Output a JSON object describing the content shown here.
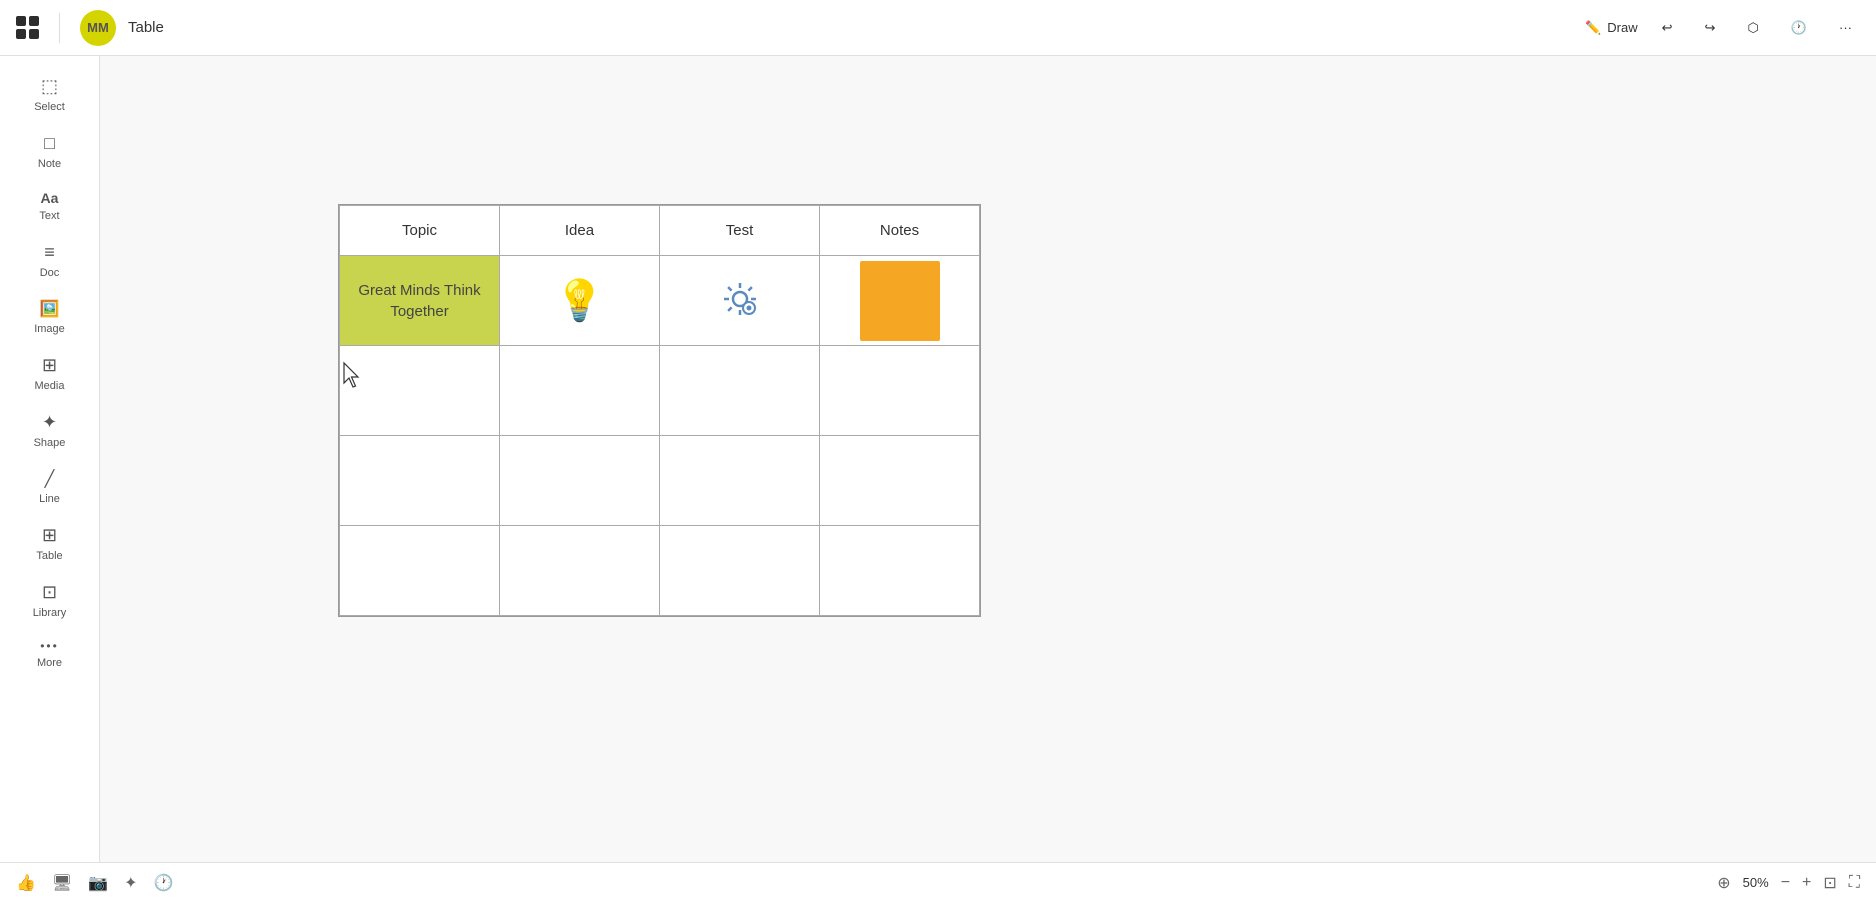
{
  "header": {
    "logo_label": "AFFiNE logo",
    "avatar_text": "MM",
    "doc_title": "Table",
    "draw_label": "Draw",
    "undo_label": "Undo",
    "redo_label": "Redo",
    "share_label": "Share",
    "history_label": "History",
    "more_label": "More"
  },
  "sidebar": {
    "items": [
      {
        "id": "select",
        "label": "Select",
        "icon": "⬚"
      },
      {
        "id": "note",
        "label": "Note",
        "icon": "□"
      },
      {
        "id": "text",
        "label": "Text",
        "icon": "Aa"
      },
      {
        "id": "doc",
        "label": "Doc",
        "icon": "≡"
      },
      {
        "id": "image",
        "label": "Image",
        "icon": "🖼"
      },
      {
        "id": "media",
        "label": "Media",
        "icon": "⊞"
      },
      {
        "id": "shape",
        "label": "Shape",
        "icon": "◇"
      },
      {
        "id": "line",
        "label": "Line",
        "icon": "╱"
      },
      {
        "id": "table",
        "label": "Table",
        "icon": "⊞"
      },
      {
        "id": "library",
        "label": "Library",
        "icon": "⊡"
      },
      {
        "id": "more",
        "label": "More",
        "icon": "···"
      }
    ]
  },
  "table": {
    "headers": [
      "Topic",
      "Idea",
      "Test",
      "Notes"
    ],
    "cell_topic_text": "Great Minds Think Together"
  },
  "bottom_bar": {
    "zoom_label": "50%",
    "zoom_icon": "⊕",
    "minus_label": "−",
    "plus_label": "+",
    "fit_label": "fit"
  }
}
